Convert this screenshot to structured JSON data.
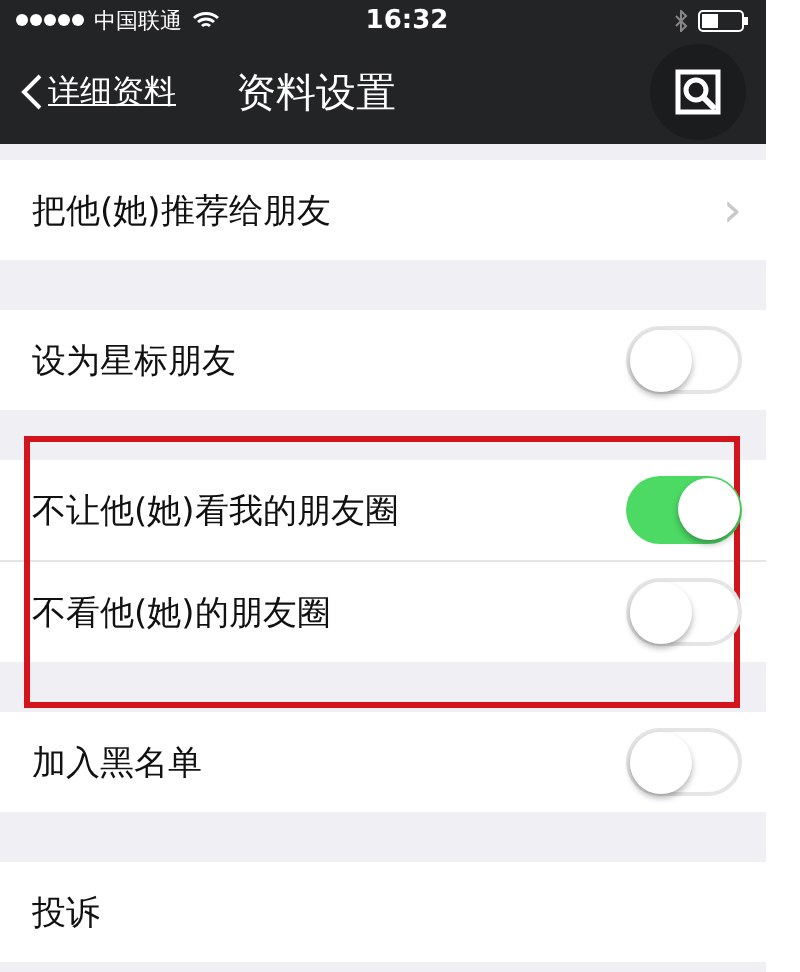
{
  "status_bar": {
    "carrier": "中国联通",
    "time": "16:32"
  },
  "nav_bar": {
    "back_label": "详细资料",
    "title": "资料设置"
  },
  "sections": [
    {
      "highlighted": false,
      "rows": [
        {
          "kind": "link",
          "label": "把他(她)推荐给朋友",
          "chevron": "›"
        }
      ]
    },
    {
      "highlighted": false,
      "rows": [
        {
          "kind": "toggle",
          "label": "设为星标朋友",
          "on": false
        }
      ]
    },
    {
      "highlighted": true,
      "rows": [
        {
          "kind": "toggle",
          "label": "不让他(她)看我的朋友圈",
          "on": true
        },
        {
          "kind": "toggle",
          "label": "不看他(她)的朋友圈",
          "on": false
        }
      ]
    },
    {
      "highlighted": false,
      "rows": [
        {
          "kind": "toggle",
          "label": "加入黑名单",
          "on": false
        }
      ]
    },
    {
      "highlighted": false,
      "rows": [
        {
          "kind": "link",
          "label": "投诉"
        }
      ]
    }
  ]
}
